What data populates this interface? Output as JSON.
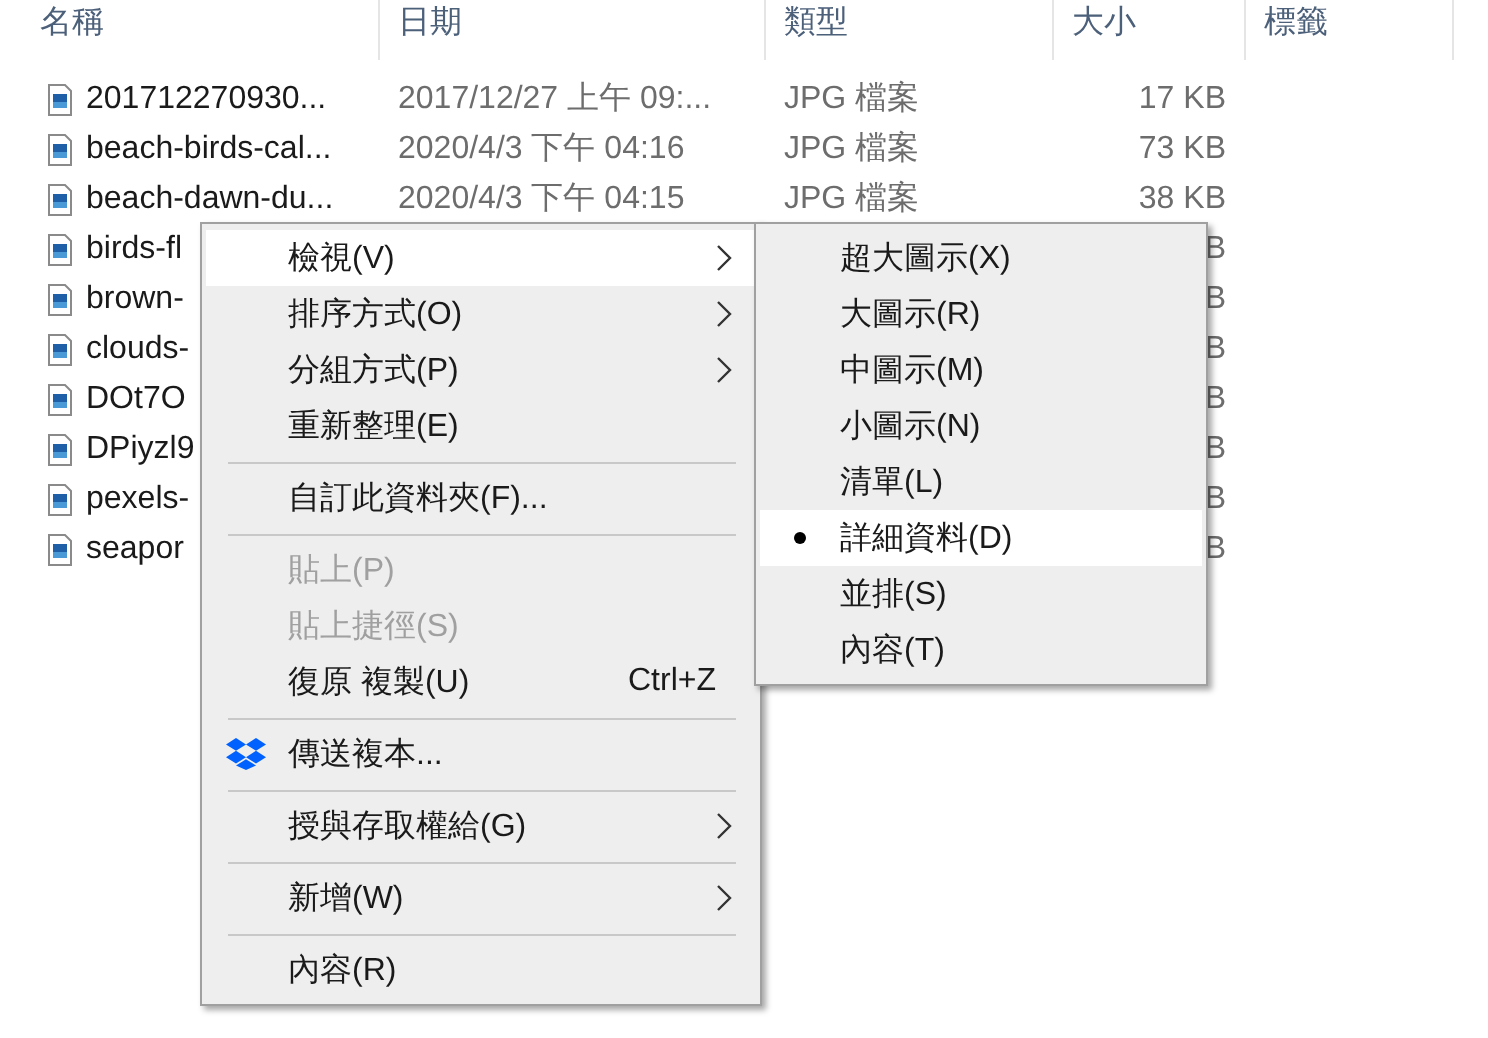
{
  "columns": [
    "名稱",
    "日期",
    "類型",
    "大小",
    "標籤"
  ],
  "files": [
    {
      "name": "201712270930...",
      "date": "2017/12/27 上午 09:...",
      "type": "JPG 檔案",
      "size": "17 KB"
    },
    {
      "name": "beach-birds-cal...",
      "date": "2020/4/3 下午 04:16",
      "type": "JPG 檔案",
      "size": "73 KB"
    },
    {
      "name": "beach-dawn-du...",
      "date": "2020/4/3 下午 04:15",
      "type": "JPG 檔案",
      "size": "38 KB"
    },
    {
      "name": "birds-fl",
      "size": "B"
    },
    {
      "name": "brown-",
      "size": "B"
    },
    {
      "name": "clouds-",
      "size": "B"
    },
    {
      "name": "DOt7O",
      "size": "B"
    },
    {
      "name": "DPiyzl9",
      "size": "B"
    },
    {
      "name": "pexels-",
      "size": "B"
    },
    {
      "name": "seapor",
      "size": "B"
    }
  ],
  "context_menu": [
    {
      "kind": "item",
      "label": "檢視(V)",
      "arrow": true,
      "disabled": false,
      "highlighted": true
    },
    {
      "kind": "item",
      "label": "排序方式(O)",
      "arrow": true,
      "disabled": false,
      "highlighted": false
    },
    {
      "kind": "item",
      "label": "分組方式(P)",
      "arrow": true,
      "disabled": false,
      "highlighted": false
    },
    {
      "kind": "item",
      "label": "重新整理(E)",
      "arrow": false,
      "disabled": false,
      "highlighted": false
    },
    {
      "kind": "separator"
    },
    {
      "kind": "item",
      "label": "自訂此資料夾(F)...",
      "arrow": false,
      "disabled": false,
      "highlighted": false
    },
    {
      "kind": "separator"
    },
    {
      "kind": "item",
      "label": "貼上(P)",
      "arrow": false,
      "disabled": true,
      "highlighted": false
    },
    {
      "kind": "item",
      "label": "貼上捷徑(S)",
      "arrow": false,
      "disabled": true,
      "highlighted": false
    },
    {
      "kind": "item",
      "label": "復原 複製(U)",
      "shortcut": "Ctrl+Z",
      "arrow": false,
      "disabled": false,
      "highlighted": false
    },
    {
      "kind": "separator"
    },
    {
      "kind": "icon_item",
      "label": "傳送複本...",
      "arrow": false,
      "disabled": false,
      "highlighted": false
    },
    {
      "kind": "separator"
    },
    {
      "kind": "item",
      "label": "授與存取權給(G)",
      "arrow": true,
      "disabled": false,
      "highlighted": false
    },
    {
      "kind": "separator"
    },
    {
      "kind": "item",
      "label": "新增(W)",
      "arrow": true,
      "disabled": false,
      "highlighted": false
    },
    {
      "kind": "separator"
    },
    {
      "kind": "item",
      "label": "內容(R)",
      "arrow": false,
      "disabled": false,
      "highlighted": false
    }
  ],
  "view_submenu": [
    {
      "label": "超大圖示(X)",
      "selected": false,
      "highlighted": false
    },
    {
      "label": "大圖示(R)",
      "selected": false,
      "highlighted": false
    },
    {
      "label": "中圖示(M)",
      "selected": false,
      "highlighted": false
    },
    {
      "label": "小圖示(N)",
      "selected": false,
      "highlighted": false
    },
    {
      "label": "清單(L)",
      "selected": false,
      "highlighted": false
    },
    {
      "label": "詳細資料(D)",
      "selected": true,
      "highlighted": true
    },
    {
      "label": "並排(S)",
      "selected": false,
      "highlighted": false
    },
    {
      "label": "內容(T)",
      "selected": false,
      "highlighted": false
    }
  ]
}
